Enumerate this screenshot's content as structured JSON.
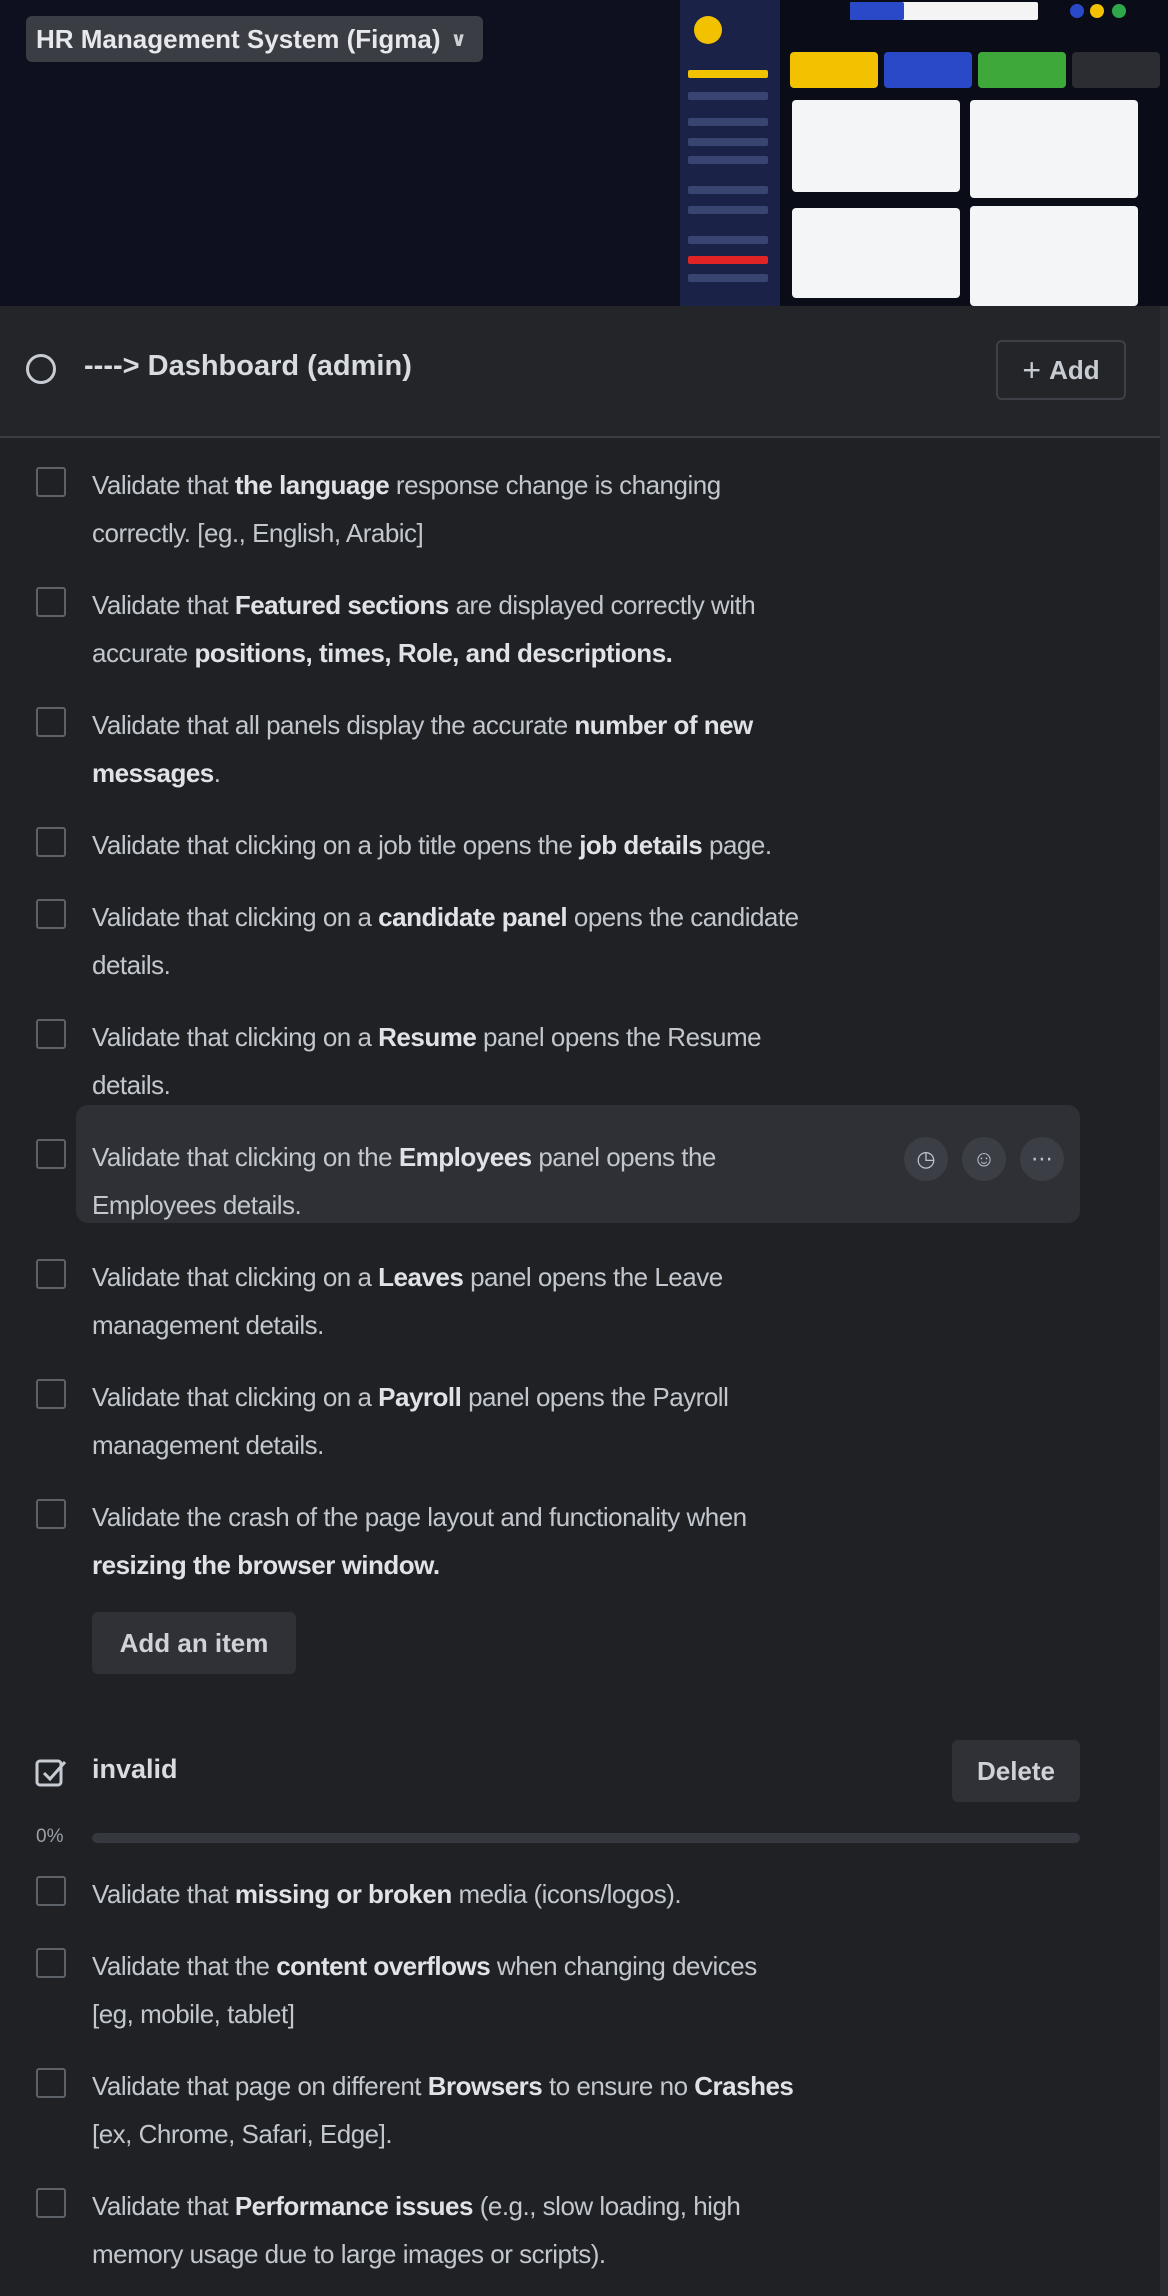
{
  "board": {
    "name": "HR Management System (Figma)"
  },
  "section": {
    "title": "----> Dashboard (admin)",
    "add_label": "Add"
  },
  "checklist_items": [
    {
      "parts": [
        [
          "Validate that ",
          false
        ],
        [
          "the language",
          true
        ],
        [
          " response change is changing",
          false
        ],
        [
          "\n",
          false
        ],
        [
          "correctly. [eg., English, Arabic]",
          false
        ]
      ]
    },
    {
      "parts": [
        [
          "Validate that ",
          false
        ],
        [
          "Featured sections",
          true
        ],
        [
          " are displayed correctly with",
          false
        ],
        [
          "\n",
          false
        ],
        [
          "accurate ",
          false
        ],
        [
          "positions, times, Role, and descriptions.",
          true
        ]
      ]
    },
    {
      "parts": [
        [
          "Validate that all panels display the accurate ",
          false
        ],
        [
          "number of new",
          true
        ],
        [
          "\n",
          false
        ],
        [
          "messages",
          true
        ],
        [
          ".",
          false
        ]
      ]
    },
    {
      "parts": [
        [
          "Validate that clicking on a job title opens the ",
          false
        ],
        [
          "job details",
          true
        ],
        [
          " page.",
          false
        ]
      ]
    },
    {
      "parts": [
        [
          "Validate that clicking on a ",
          false
        ],
        [
          "candidate panel",
          true
        ],
        [
          " opens the candidate",
          false
        ],
        [
          "\n",
          false
        ],
        [
          "details.",
          false
        ]
      ]
    },
    {
      "parts": [
        [
          "Validate that clicking on a ",
          false
        ],
        [
          "Resume",
          true
        ],
        [
          " panel opens the Resume",
          false
        ],
        [
          "\n",
          false
        ],
        [
          "details.",
          false
        ]
      ]
    },
    {
      "parts": [
        [
          "Validate that clicking on the ",
          false
        ],
        [
          "Employees",
          true
        ],
        [
          " panel opens the",
          false
        ],
        [
          "\n",
          false
        ],
        [
          "Employees details.",
          false
        ]
      ]
    },
    {
      "parts": [
        [
          "Validate that clicking on a ",
          false
        ],
        [
          "Leaves",
          true
        ],
        [
          " panel opens the Leave",
          false
        ],
        [
          "\n",
          false
        ],
        [
          "management details.",
          false
        ]
      ]
    },
    {
      "parts": [
        [
          "Validate that clicking on a ",
          false
        ],
        [
          "Payroll",
          true
        ],
        [
          " panel opens the Payroll",
          false
        ],
        [
          "\n",
          false
        ],
        [
          "management details.",
          false
        ]
      ]
    },
    {
      "parts": [
        [
          "Validate the crash of the page layout and functionality when",
          false
        ],
        [
          "\n",
          false
        ],
        [
          "resizing the browser window.",
          true
        ]
      ]
    }
  ],
  "add_item_label": "Add an item",
  "invalid": {
    "title": "invalid",
    "delete_label": "Delete",
    "progress_label": "0%",
    "progress": 0,
    "items": [
      {
        "parts": [
          [
            "Validate that ",
            false
          ],
          [
            "missing or broken",
            true
          ],
          [
            " media (icons/logos).",
            false
          ]
        ]
      },
      {
        "parts": [
          [
            "Validate that the ",
            false
          ],
          [
            "content overflows",
            true
          ],
          [
            " when changing devices",
            false
          ],
          [
            "\n",
            false
          ],
          [
            "[eg, mobile, tablet]",
            false
          ]
        ]
      },
      {
        "parts": [
          [
            "Validate that page on different ",
            false
          ],
          [
            "Browsers",
            true
          ],
          [
            " to ensure no ",
            false
          ],
          [
            "Crashes",
            true
          ],
          [
            "\n",
            false
          ],
          [
            "[ex, Chrome, Safari, Edge].",
            false
          ]
        ]
      },
      {
        "parts": [
          [
            "Validate that ",
            false
          ],
          [
            "Performance issues",
            true
          ],
          [
            " (e.g., slow loading, high",
            false
          ],
          [
            "\n",
            false
          ],
          [
            "memory usage due to large images or scripts).",
            false
          ]
        ]
      }
    ]
  },
  "icons": {
    "chevron": "chevron-down-icon",
    "circle": "circle-icon",
    "plus": "plus-icon",
    "clock": "clock-icon",
    "assign": "assign-member-icon",
    "more": "more-icon",
    "checklist": "checklist-icon"
  },
  "colors": {
    "background": "#1f2125",
    "header_bg": "#0e1020",
    "accent": "#5a8dee"
  }
}
